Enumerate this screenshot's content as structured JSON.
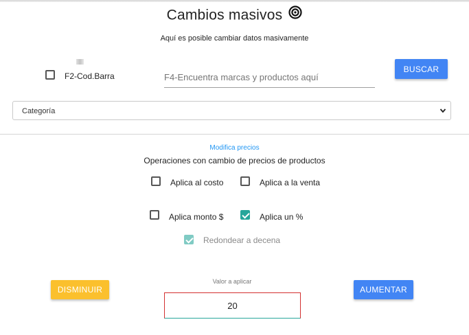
{
  "header": {
    "title": "Cambios masivos",
    "title_icon": "target-icon",
    "subtitle": "Aquí es posible cambiar datos masivamente"
  },
  "search": {
    "barcode_checkbox": {
      "label": "F2-Cod.Barra",
      "checked": false
    },
    "placeholder": "F4-Encuentra marcas y productos aquí",
    "value": "",
    "button_label": "BUSCAR"
  },
  "category_select": {
    "selected": "Categoría",
    "icon": "chevron-down-icon"
  },
  "prices": {
    "section_link": "Modifica precios",
    "section_title": "Operaciones con cambio de precios de productos",
    "options": {
      "costo": {
        "label": "Aplica al costo",
        "checked": false
      },
      "venta": {
        "label": "Aplica a la venta",
        "checked": false
      },
      "monto": {
        "label": "Aplica monto $",
        "checked": false
      },
      "porcentaje": {
        "label": "Aplica un %",
        "checked": true
      },
      "redondear": {
        "label": "Redondear a decena",
        "checked": true,
        "disabled": true
      }
    }
  },
  "apply": {
    "value_label": "Valor a aplicar",
    "value": "20",
    "decrease_label": "DISMINUIR",
    "increase_label": "AUMENTAR"
  },
  "colors": {
    "primary": "#4285f4",
    "warning": "#fbc02d",
    "checked": "#26a69a",
    "link": "#2196f3",
    "error_border": "#d32f2f"
  }
}
